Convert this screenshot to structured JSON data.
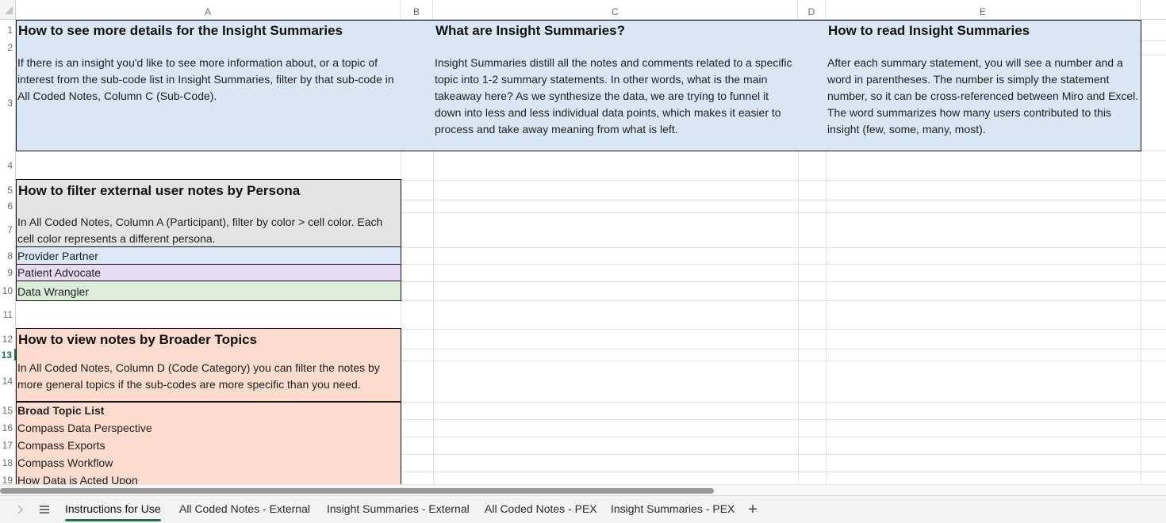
{
  "columns": [
    "A",
    "B",
    "C",
    "D",
    "E"
  ],
  "rows": [
    "1",
    "2",
    "3",
    "4",
    "5",
    "6",
    "7",
    "8",
    "9",
    "10",
    "11",
    "12",
    "13",
    "14",
    "15",
    "16",
    "17",
    "18",
    "19"
  ],
  "selected_row": "13",
  "section1": {
    "col_a": {
      "title": "How to see more details for the Insight Summaries",
      "body": "If there is an insight you'd like to see more information about, or a topic of interest from the sub-code list in Insight Summaries, filter by that sub-code in All Coded Notes, Column C (Sub-Code)."
    },
    "col_c": {
      "title": "What are Insight Summaries?",
      "body": "Insight Summaries distill all the notes and comments related to a specific topic into 1-2 summary statements. In other words, what is the main takeaway here? As we synthesize the data, we are trying to funnel it down into less and less individual data points, which makes it easier to process and take away meaning from what is left."
    },
    "col_e": {
      "title": "How to read Insight Summaries",
      "body": "After each summary statement, you will see a number and a word in parentheses. The number is simply the statement number, so it can be cross-referenced between Miro and Excel. The word summarizes how many users contributed to this insight (few, some, many, most)."
    }
  },
  "persona": {
    "title": "How to filter external user notes by Persona",
    "body": "In All Coded Notes, Column A (Participant), filter by color > cell color. Each cell color represents a different persona.",
    "items": [
      "Provider Partner",
      "Patient Advocate",
      "Data Wrangler"
    ]
  },
  "topics": {
    "title": "How to view notes by Broader Topics",
    "body": "In All Coded Notes, Column D (Code Category) you can filter the notes by more general topics if the sub-codes are more specific than you need.",
    "list_header": "Broad Topic List",
    "items": [
      "Compass Data Perspective",
      "Compass Exports",
      "Compass Workflow",
      "How Data is Acted Upon"
    ]
  },
  "colors": {
    "blue_block": "#d9e7f5",
    "persona_block": "#e3e3e3",
    "provider_partner": "#dce8f4",
    "patient_advocate": "#e8dbf3",
    "data_wrangler": "#dcedd9",
    "topics_block": "#fbdccf",
    "active_tab_accent": "#1e7145"
  },
  "tabs": {
    "nav_icon": "chevron-right-icon",
    "menu_icon": "hamburger-icon",
    "add_icon": "plus-icon",
    "items": [
      {
        "label": "Instructions for Use",
        "active": true
      },
      {
        "label": "All Coded Notes - External",
        "active": false
      },
      {
        "label": "Insight Summaries - External",
        "active": false
      },
      {
        "label": "All Coded Notes - PEX",
        "active": false
      },
      {
        "label": "Insight Summaries - PEX",
        "active": false
      }
    ],
    "add_label": "+"
  }
}
